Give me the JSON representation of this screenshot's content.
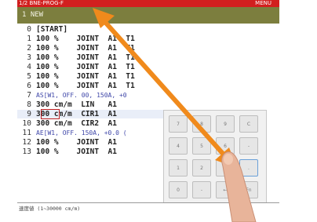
{
  "titlebar": {
    "left": "1/2 BNE-PROG-F",
    "right": "MENU"
  },
  "program": {
    "header": "1 NEW"
  },
  "lines": [
    {
      "num": "0",
      "text": "[START]"
    },
    {
      "num": "1",
      "text": "100 %    JOINT  A1  T1"
    },
    {
      "num": "2",
      "text": "100 %    JOINT  A1  T1"
    },
    {
      "num": "3",
      "text": "100 %    JOINT  A1  T1"
    },
    {
      "num": "4",
      "text": "100 %    JOINT  A1  T1"
    },
    {
      "num": "5",
      "text": "100 %    JOINT  A1  T1"
    },
    {
      "num": "6",
      "text": "100 %    JOINT  A1  T1"
    },
    {
      "num": "7",
      "text": "AS[W1, OFF. 00, 150A, +0"
    },
    {
      "num": "8",
      "text": "300 cm/m  LIN   A1"
    },
    {
      "num": "9",
      "text": "300 cm/m  CIR1  A1"
    },
    {
      "num": "10",
      "text": "300 cm/m  CIR2  A1"
    },
    {
      "num": "11",
      "text": "AE[W1, OFF. 150A, +0.0 ("
    },
    {
      "num": "12",
      "text": "100 %    JOINT  A1"
    },
    {
      "num": "13",
      "text": "100 %    JOINT  A1"
    }
  ],
  "keypad": {
    "row1": [
      "7",
      "8",
      "9",
      "C"
    ],
    "row2": [
      "4",
      "5",
      "6",
      "-"
    ],
    "row3": [
      "1",
      "2",
      "3",
      "."
    ],
    "row4": [
      "0",
      "-",
      "←",
      "Fn"
    ]
  },
  "bottom": {
    "hint": "速度値 (1~30000 cm/m)"
  }
}
